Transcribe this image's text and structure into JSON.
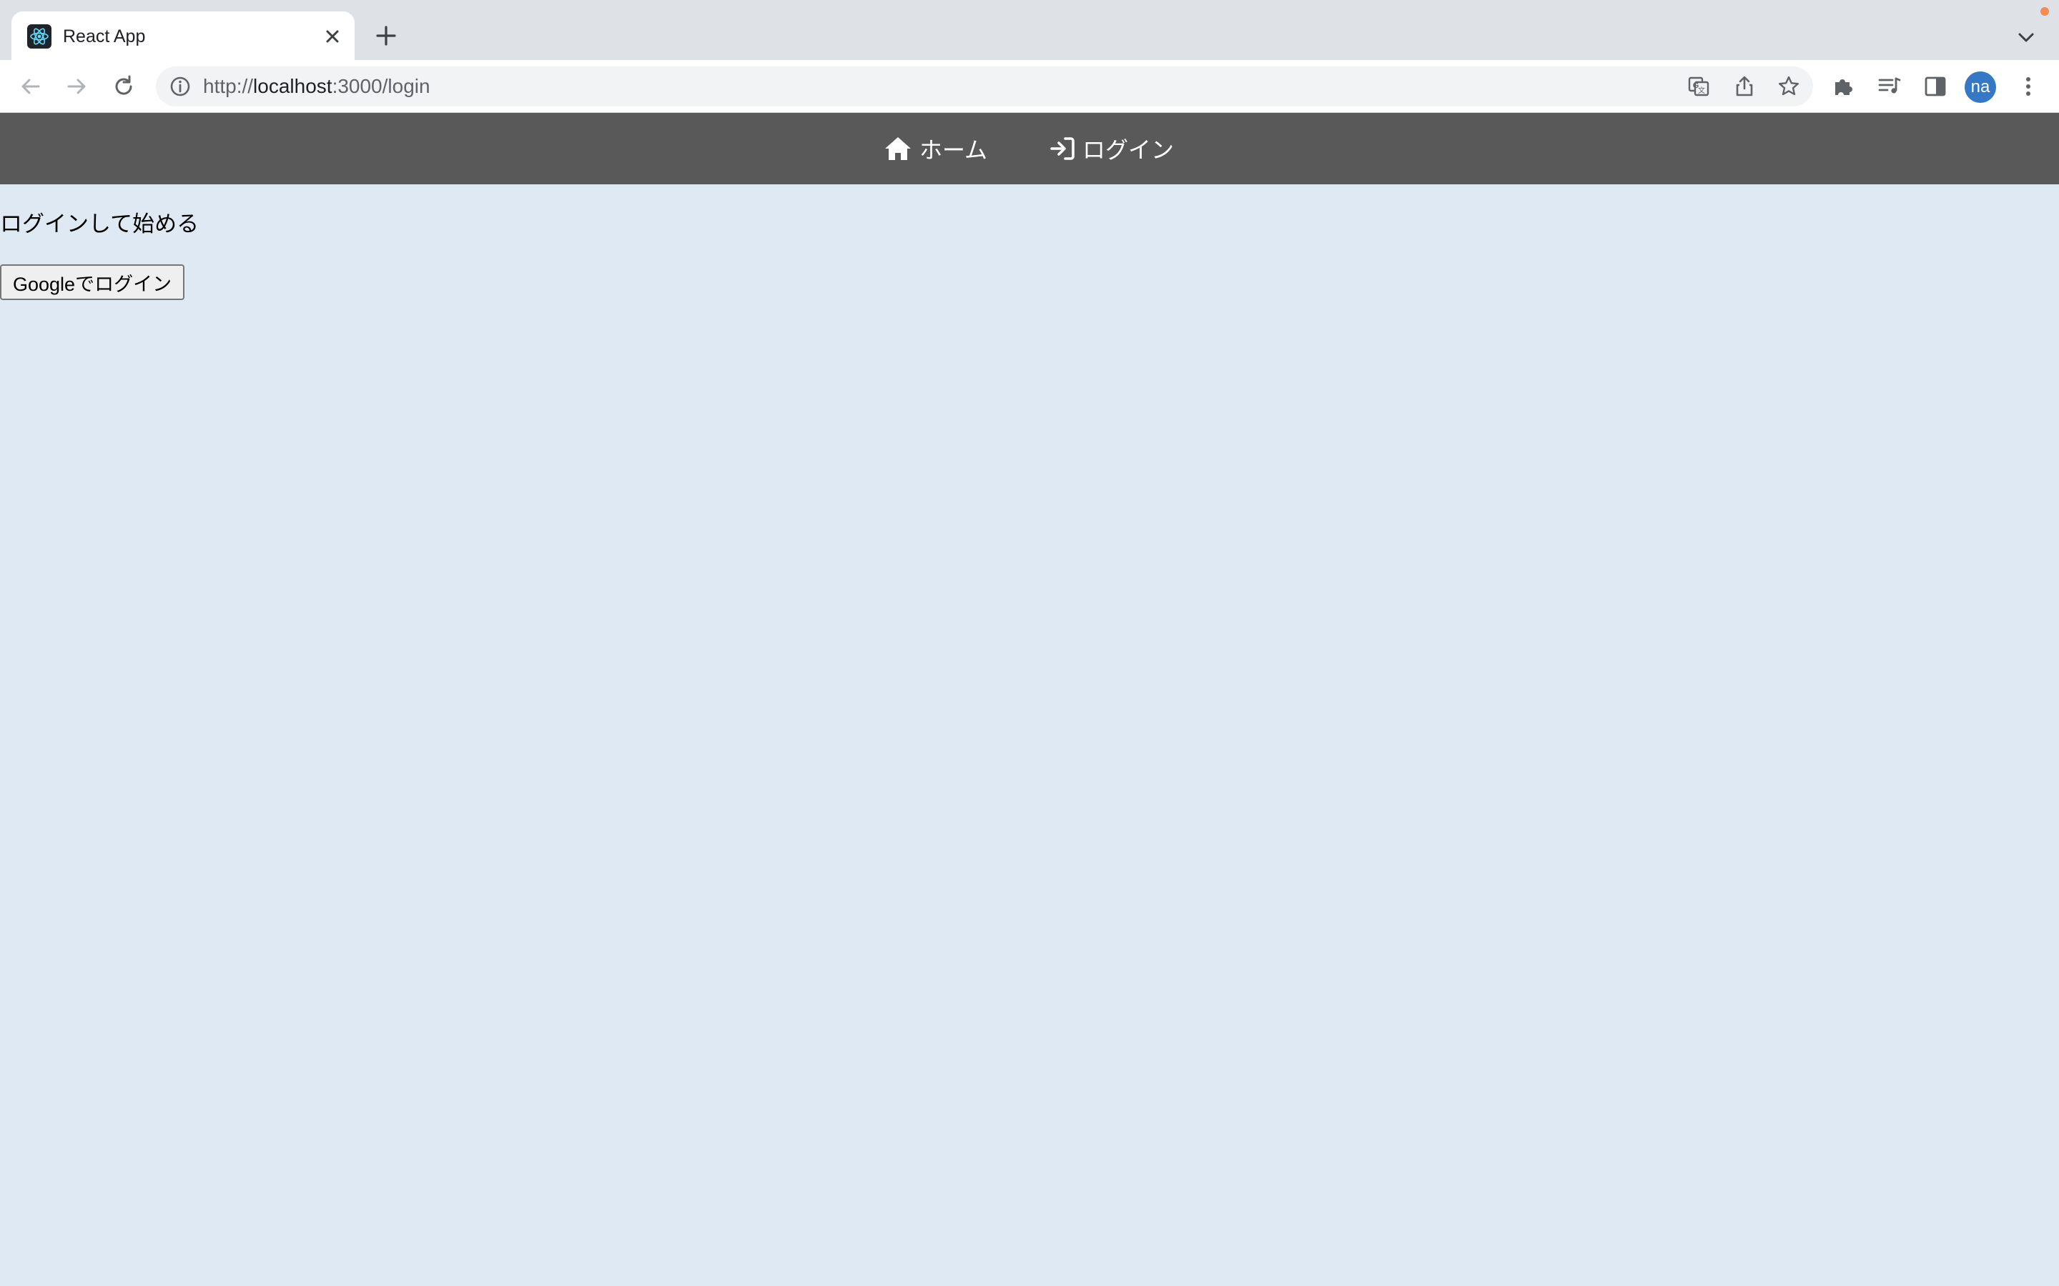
{
  "browser": {
    "tab": {
      "title": "React App",
      "favicon": "react-logo-icon"
    },
    "address_bar": {
      "scheme": "http://",
      "host": "localhost",
      "rest": ":3000/login"
    },
    "profile_initials": "na",
    "colors": {
      "tabstrip": "#dee1e6",
      "omnibox": "#f1f3f4",
      "avatar": "#3478c6"
    }
  },
  "app": {
    "nav": {
      "home_label": "ホーム",
      "login_label": "ログイン"
    },
    "login": {
      "heading": "ログインして始める",
      "google_button": "Googleでログイン"
    },
    "colors": {
      "navbar": "#595959",
      "background": "#dfe9f3"
    }
  }
}
